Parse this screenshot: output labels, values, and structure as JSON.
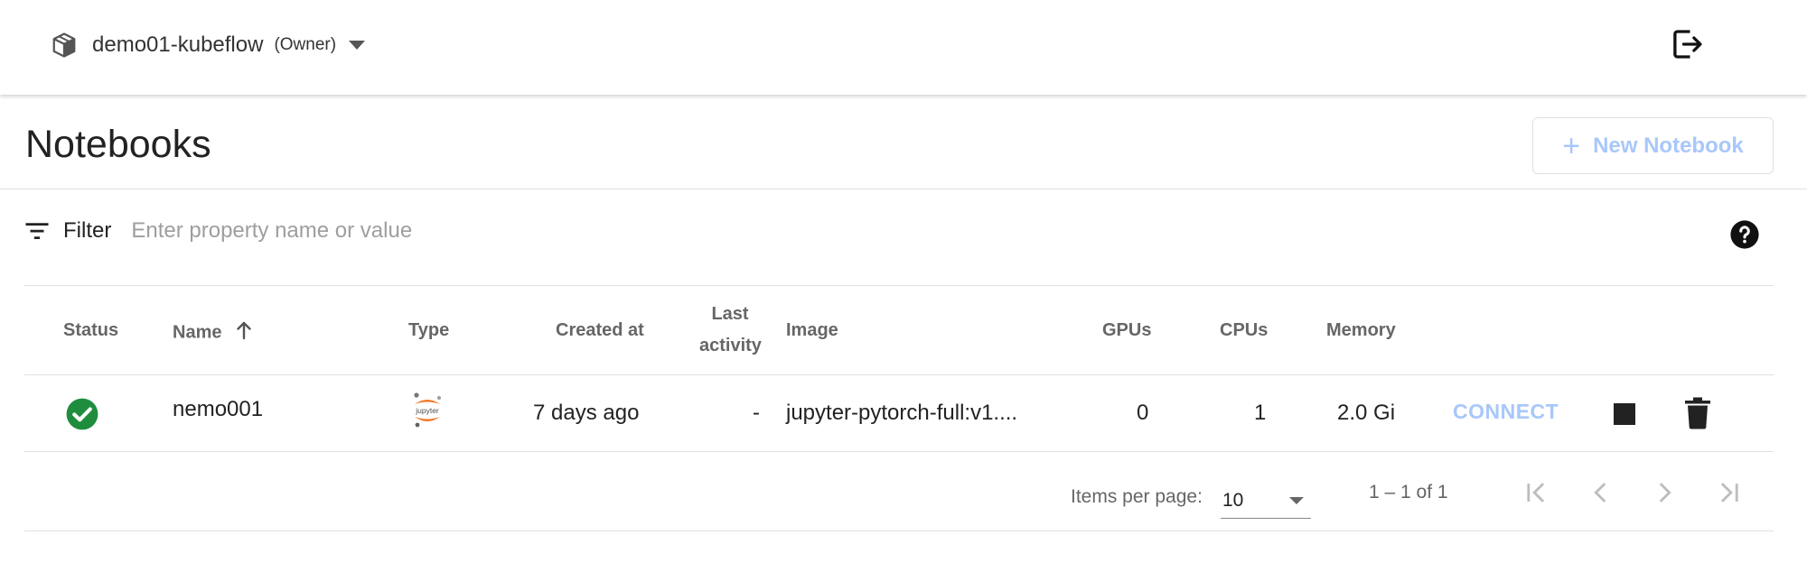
{
  "topbar": {
    "namespace": "demo01-kubeflow",
    "role": "(Owner)",
    "namespace_icon": "cube-icon",
    "logout_icon": "logout-icon"
  },
  "page": {
    "title": "Notebooks",
    "new_button_label": "New Notebook",
    "new_button_icon": "plus-icon"
  },
  "filter": {
    "label": "Filter",
    "placeholder": "Enter property name or value",
    "value": "",
    "help_icon": "help-icon"
  },
  "table": {
    "headers": {
      "status": "Status",
      "name": "Name",
      "type": "Type",
      "created": "Created at",
      "last_activity_line1": "Last",
      "last_activity_line2": "activity",
      "image": "Image",
      "gpus": "GPUs",
      "cpus": "CPUs",
      "memory": "Memory"
    },
    "rows": [
      {
        "status_icon": "check-circle-icon",
        "name": "nemo001",
        "type_icon": "jupyter-logo",
        "type_logo_text": "jupyter",
        "created": "7 days ago",
        "last_activity": "-",
        "image": "jupyter-pytorch-full:v1....",
        "gpus": "0",
        "cpus": "1",
        "memory": "2.0 Gi",
        "connect_label": "CONNECT",
        "stop_icon": "stop-icon",
        "delete_icon": "trash-icon"
      }
    ]
  },
  "paginator": {
    "items_per_page_label": "Items per page:",
    "items_per_page": "10",
    "range": "1 – 1 of 1"
  },
  "colors": {
    "status_ok": "#1e8e3e",
    "accent_disabled": "#a8c7fa",
    "jupyter_orange": "#f37726"
  }
}
